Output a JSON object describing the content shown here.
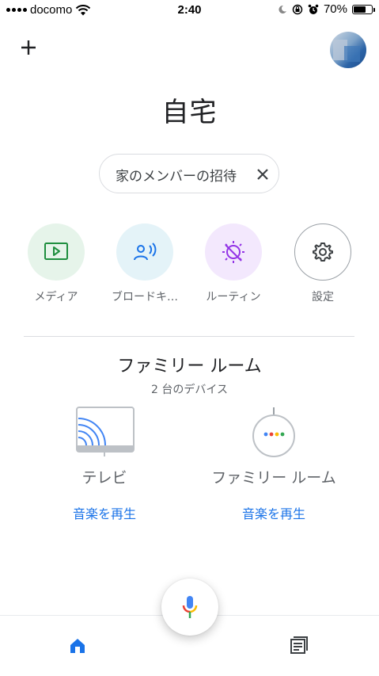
{
  "status_bar": {
    "carrier": "docomo",
    "time": "2:40",
    "battery_percent": "70%",
    "battery_level": 0.7
  },
  "header": {
    "title": "自宅",
    "add_icon": "plus-icon",
    "avatar_icon": "account-avatar"
  },
  "invite_chip": {
    "label": "家のメンバーの招待",
    "close_icon": "close-icon"
  },
  "actions": [
    {
      "label": "メディア",
      "icon": "media-play-icon",
      "bg": "#e6f4ea",
      "color": "#1e8e3e"
    },
    {
      "label": "ブロードキ…",
      "icon": "broadcast-icon",
      "bg": "#e4f3f8",
      "color": "#1a73e8"
    },
    {
      "label": "ルーティン",
      "icon": "routine-sun-icon",
      "bg": "#f3e8fd",
      "color": "#9334e6"
    },
    {
      "label": "設定",
      "icon": "gear-icon",
      "bg": "#ffffff",
      "color": "#5f6368"
    }
  ],
  "room": {
    "name": "ファミリー ルーム",
    "device_count": "2 台のデバイス",
    "devices": [
      {
        "name": "テレビ",
        "icon": "tv-cast-icon",
        "action": "音楽を再生"
      },
      {
        "name": "ファミリー ルーム",
        "icon": "google-home-mini-icon",
        "action": "音楽を再生"
      }
    ]
  },
  "bottom_nav": {
    "mic_icon": "microphone-icon",
    "home_icon": "home-icon",
    "feed_icon": "feed-icon"
  },
  "colors": {
    "accent_blue": "#1a73e8",
    "google_blue": "#4285f4",
    "google_red": "#ea4335",
    "google_yellow": "#fbbc04",
    "google_green": "#34a853"
  }
}
